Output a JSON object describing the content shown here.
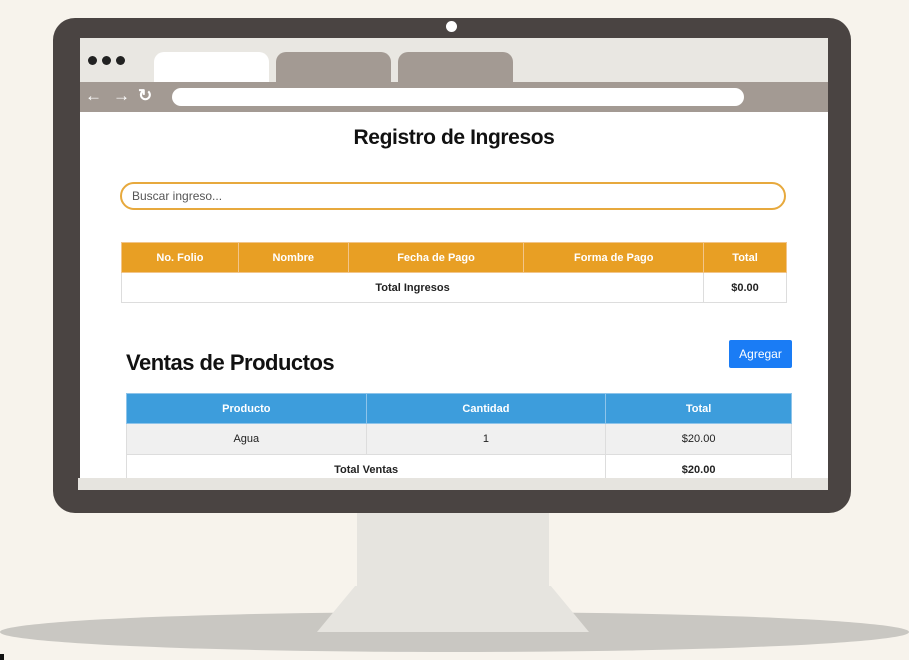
{
  "browser": {
    "tabs": [
      {
        "label": ""
      },
      {
        "label": ""
      },
      {
        "label": ""
      }
    ],
    "address_value": ""
  },
  "page": {
    "title": "Registro de Ingresos",
    "search_placeholder": "Buscar ingreso...",
    "ingresos_table": {
      "headers": [
        "No. Folio",
        "Nombre",
        "Fecha de Pago",
        "Forma de Pago",
        "Total"
      ],
      "total_label": "Total Ingresos",
      "total_value": "$0.00"
    },
    "ventas": {
      "title": "Ventas de Productos",
      "add_button": "Agregar",
      "headers": [
        "Producto",
        "Cantidad",
        "Total"
      ],
      "rows": [
        {
          "producto": "Agua",
          "cantidad": "1",
          "total": "$20.00"
        }
      ],
      "total_label": "Total Ventas",
      "total_value": "$20.00"
    }
  },
  "colors": {
    "ingresos_header": "#e89f24",
    "ventas_header": "#3d9ddc",
    "add_button": "#1a7cf5",
    "search_border": "#e7a93d"
  },
  "icons": {
    "back": "arrow-left-icon",
    "forward": "arrow-right-icon",
    "reload": "reload-icon"
  }
}
